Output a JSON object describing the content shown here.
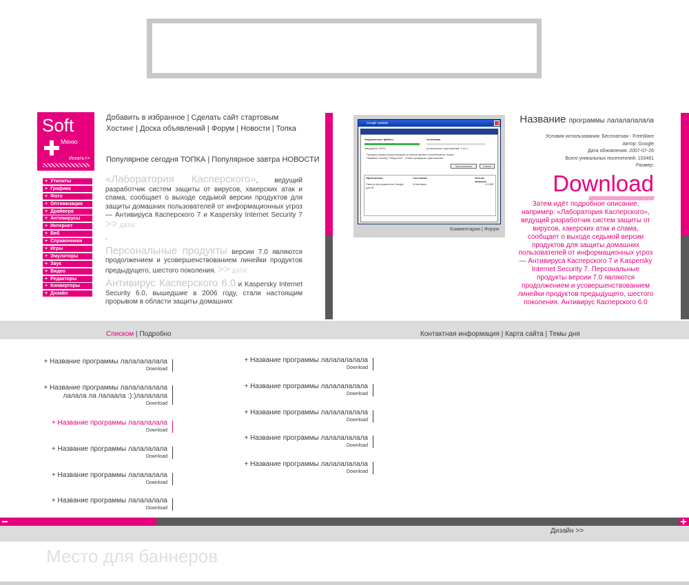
{
  "logo": {
    "title": "Soft",
    "menu": "Меню",
    "search": "Искать>>"
  },
  "top_links": {
    "line1": "Добавить в избранное | Сделать сайт стартовым",
    "line2": "Хостинг | Доска объявлений | Форум | Новости | Топка",
    "popular": "Популярное сегодня ТОПКА | Популярное завтра НОВОСТИ"
  },
  "categories": [
    "Утилиты",
    "Графика",
    "Фото",
    "Оптимизация",
    "Драйвера",
    "Антивирусы",
    "Интернет",
    "Веб",
    "Справочники",
    "Игры",
    "Эмуляторы",
    "Звук",
    "Видео",
    "Редакторы",
    "Конверторы",
    "Дизайн"
  ],
  "article": {
    "p1_title": "«Лаборатория Касперского»",
    "p1_text": ", ведущий разработчик систем защиты от вирусов, хакерских атак и спама, сообщает о выходе седьмой версии продуктов для защиты домашних пользователей от информационных угроз — Антивируса Касперского 7 и Kaspersky Internet Security 7",
    "arrows": ">>",
    "date": "дата:",
    "dot": ".",
    "p2_title": "Персональные продукты",
    "p2_text": " версии 7.0 являются продолжением и усовершенствованием линейки продуктов предыдущего, шестого поколения.",
    "p3_title": "Антивирус Касперского 6.0",
    "p3_text": " и Kaspersky Internet Security 6.0, вышедшие в 2006 году, стали настоящим прорывом в области защиты домашних"
  },
  "screenshot": {
    "window_title": "Google Updater",
    "tabs": [
      "Текущее состояние",
      "Установленные ПО",
      "Обновление",
      "Параметры настройки",
      "Справка"
    ],
    "downloading": "Загруженные файлы",
    "installing": "Установка",
    "progress_text": "загружено 100%",
    "progress_text2": "установлено приложений: 0 из 1",
    "note1": "Процесс можно приостановить в любое время и возобновить позже.",
    "note2": "Нажмите ссылку \"Запустить\", чтобы проверить приложение.",
    "pause": "Приостановить",
    "cancel": "Отмена",
    "col_app": "Приложение",
    "col_status": "Состояние",
    "col_size": "Объем загрузки",
    "row_app": "Панель инструментов Google для IE",
    "row_status": "Установка...",
    "row_size": "0.5 Mб",
    "caption": "Комментарии | Форум"
  },
  "program": {
    "name": "Название",
    "name_rest": "программы лалалалалала",
    "usage": "Условия использования: Бесплатная - FreeWare",
    "author": "Автор: Google",
    "updated": "Дата обновления: 2007-07-26",
    "visitors": "Всего уникальных посетителей: 103481",
    "size": "Размер:",
    "download": "Download",
    "slashes": "///////////////////////////////////////////////////////",
    "description": "Затем идёт подробное описание, например: «Лаборатория Касперского», ведущий разработчик систем защиты от вирусов, хакерских атак и спама, сообщает о выходе седьмой версии продуктов для защиты домашних пользователей от информационных угроз — Антивируса Касперского 7 и Kaspersky Internet Security 7. Персональные продукты версии 7.0 являются продолжением и усовершенствованием линейки продуктов предыдущего, шестого поколения. Антивирус Касперского 6.0"
  },
  "view": {
    "list": "Списком",
    "sep": " | ",
    "detail": "Подробно"
  },
  "footer_links": "Контактная информация | Карта сайта | Темы дня",
  "list_left": [
    {
      "title": "+ Название программы лалалалалала",
      "extra": "",
      "dl": "Download",
      "pink": false
    },
    {
      "title": "+ Название программы лалалалалала",
      "extra": "лалала ла   лалаала :):)лалалала",
      "dl": "Download",
      "pink": false
    },
    {
      "title": "+ Название программы лалалалала",
      "extra": "",
      "dl": "Download",
      "pink": true
    },
    {
      "title": "+ Название программы лалалалала",
      "extra": "",
      "dl": "Download",
      "pink": false
    },
    {
      "title": "+ Название программы лалалалала",
      "extra": "",
      "dl": "Download",
      "pink": false
    },
    {
      "title": "+ Название программы лалалалала",
      "extra": "",
      "dl": "Download",
      "pink": false
    }
  ],
  "list_right": [
    {
      "title": "+ Название программы лалалалалала",
      "dl": "Download"
    },
    {
      "title": "+ Название программы лалалалалала",
      "dl": "Download"
    },
    {
      "title": "+ Название программы лалалалалала",
      "dl": "Download"
    },
    {
      "title": "+ Название программы лалалалалала",
      "dl": "Download"
    },
    {
      "title": "+ Название программы лалалалалала",
      "dl": "Download"
    }
  ],
  "design_link": "Дизайн >>",
  "banner_place": "Место для баннеров",
  "colors": {
    "accent": "#e6007e",
    "dark": "#595959",
    "light_gray": "#dcdcdc"
  }
}
